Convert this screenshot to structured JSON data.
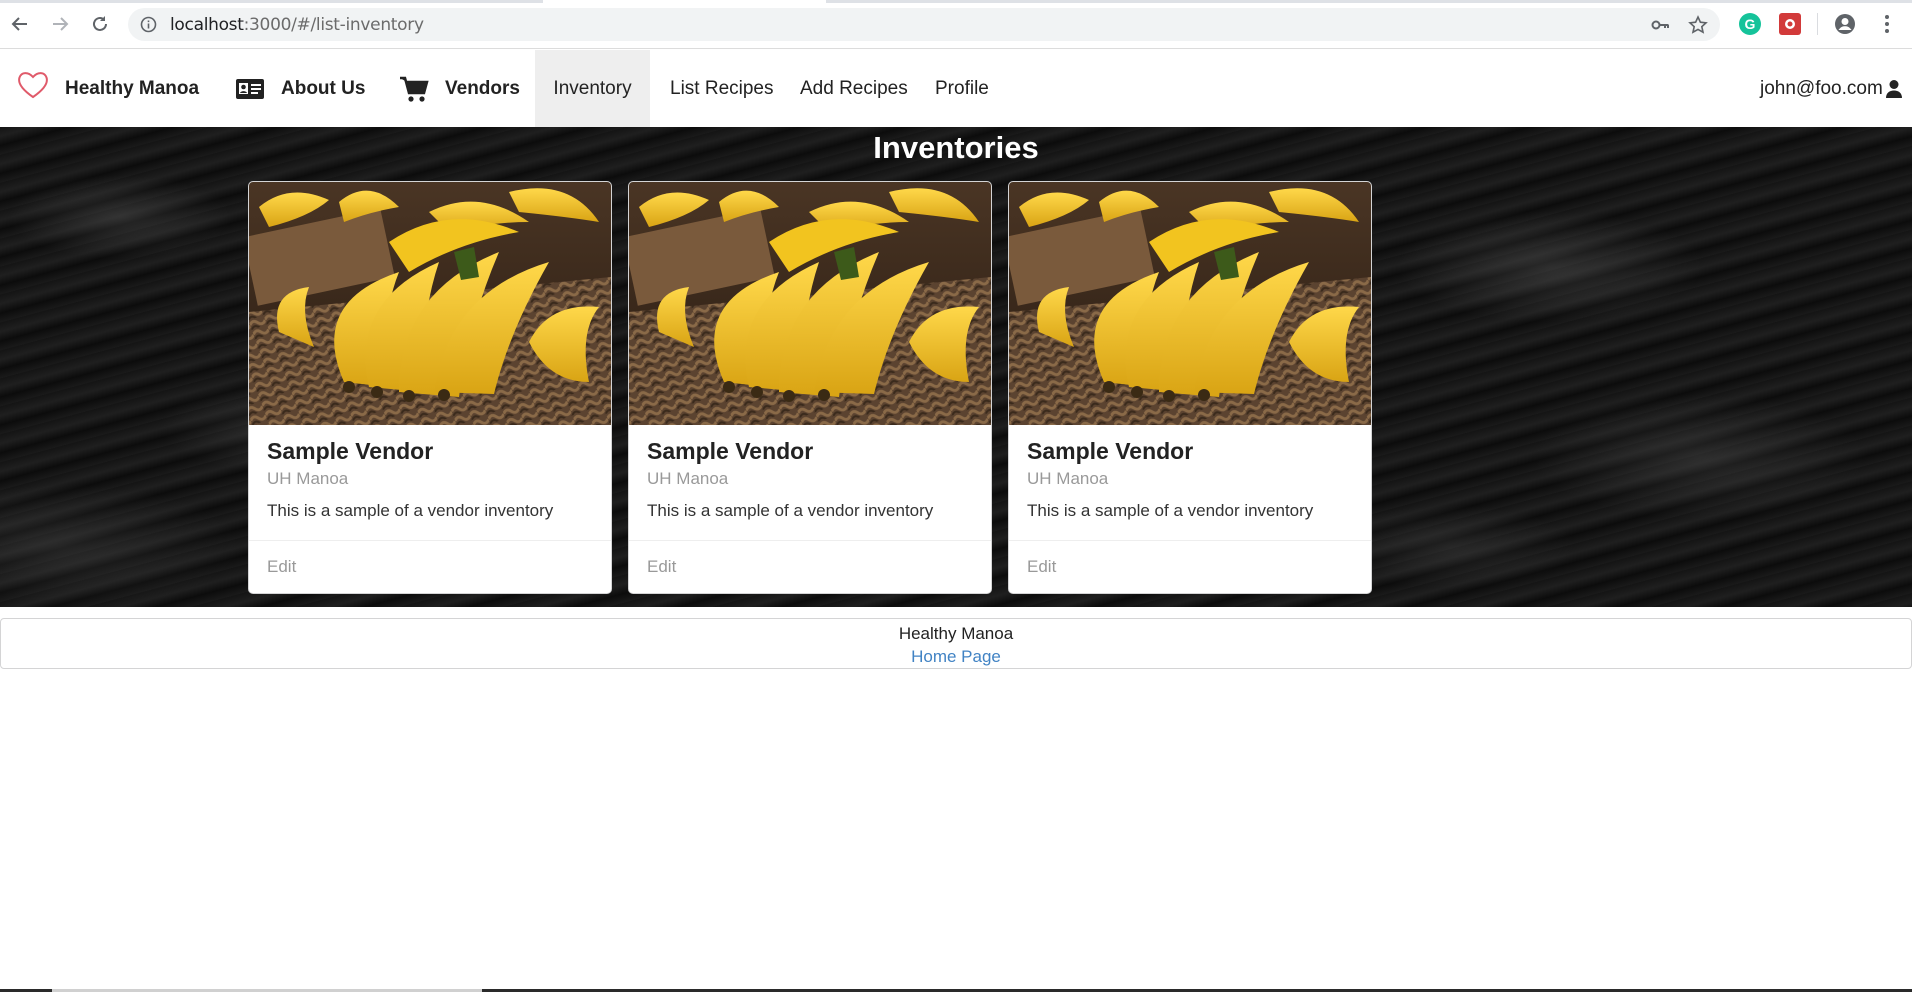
{
  "browser": {
    "url_host": "localhost",
    "url_path": ":3000/#/list-inventory"
  },
  "navbar": {
    "brand": "Healthy Manoa",
    "about": "About Us",
    "vendors": "Vendors",
    "inventory": "Inventory",
    "list_recipes": "List Recipes",
    "add_recipes": "Add Recipes",
    "profile": "Profile",
    "user": "john@foo.com"
  },
  "page": {
    "title": "Inventories"
  },
  "cards": [
    {
      "header": "Sample Vendor",
      "meta": "UH Manoa",
      "description": "This is a sample of a vendor inventory",
      "action": "Edit"
    },
    {
      "header": "Sample Vendor",
      "meta": "UH Manoa",
      "description": "This is a sample of a vendor inventory",
      "action": "Edit"
    },
    {
      "header": "Sample Vendor",
      "meta": "UH Manoa",
      "description": "This is a sample of a vendor inventory",
      "action": "Edit"
    }
  ],
  "footer": {
    "title": "Healthy Manoa",
    "link": "Home Page"
  },
  "colors": {
    "link": "#4183c4",
    "heart": "#e05a6a",
    "active_nav_bg": "#eeeeee"
  }
}
